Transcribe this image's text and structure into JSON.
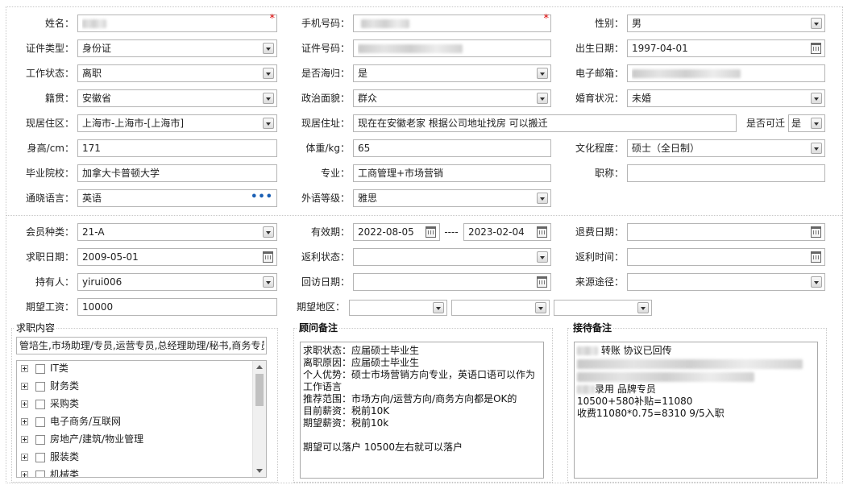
{
  "row1": {
    "name_label": "姓名：",
    "phone_label": "手机号码：",
    "gender_label": "性别：",
    "gender_value": "男",
    "required_mark": "*"
  },
  "row2": {
    "id_type_label": "证件类型：",
    "id_type_value": "身份证",
    "id_no_label": "证件号码：",
    "birth_label": "出生日期：",
    "birth_value": "1997-04-01"
  },
  "row3": {
    "work_status_label": "工作状态：",
    "work_status_value": "离职",
    "overseas_label": "是否海归：",
    "overseas_value": "是",
    "email_label": "电子邮箱："
  },
  "row4": {
    "native_label": "籍贯：",
    "native_value": "安徽省",
    "political_label": "政治面貌：",
    "political_value": "群众",
    "marital_label": "婚育状况：",
    "marital_value": "未婚"
  },
  "row5": {
    "area_label": "现居住区：",
    "area_value": "上海市-上海市-[上海市]",
    "address_label": "现居住址：",
    "address_value": "现在在安徽老家 根据公司地址找房 可以搬迁",
    "relocate_label": "是否可迁",
    "relocate_value": "是"
  },
  "row6": {
    "height_label": "身高/cm：",
    "height_value": "171",
    "weight_label": "体重/kg：",
    "weight_value": "65",
    "education_label": "文化程度：",
    "education_value": "硕士（全日制）"
  },
  "row7": {
    "school_label": "毕业院校：",
    "school_value": "加拿大卡普顿大学",
    "major_label": "专业：",
    "major_value": "工商管理+市场营销",
    "title_label": "职称：",
    "title_value": ""
  },
  "row8": {
    "language_label": "通晓语言：",
    "language_value": "英语",
    "foreign_level_label": "外语等级：",
    "foreign_level_value": "雅思"
  },
  "row9": {
    "member_label": "会员种类：",
    "member_value": "21-A",
    "validity_label": "有效期：",
    "validity_start": "2022-08-05",
    "validity_sep": "----",
    "validity_end": "2023-02-04",
    "refund_date_label": "退费日期："
  },
  "row10": {
    "job_date_label": "求职日期：",
    "job_date_value": "2009-05-01",
    "rebate_status_label": "返利状态：",
    "rebate_time_label": "返利时间："
  },
  "row11": {
    "holder_label": "持有人：",
    "holder_value": "yirui006",
    "visit_date_label": "回访日期：",
    "source_label": "来源途径："
  },
  "row12": {
    "salary_label": "期望工资：",
    "salary_value": "10000",
    "region_label": "期望地区："
  },
  "job_content": {
    "title": "求职内容",
    "summary": "管培生,市场助理/专员,运营专员,总经理助理/秘书,商务专员",
    "categories": [
      "IT类",
      "财务类",
      "采购类",
      "电子商务/互联网",
      "房地产/建筑/物业管理",
      "服装类",
      "机械类"
    ]
  },
  "consultant_notes": {
    "title": "顾问备注",
    "text": "求职状态：应届硕士毕业生\n离职原因：应届硕士毕业生\n个人优势：硕士市场营销方向专业，英语口语可以作为工作语言\n推荐范围：市场方向/运营方向/商务方向都是OK的\n目前薪资：税前10K\n期望薪资：税前10k\n\n期望可以落户 10500左右就可以落户"
  },
  "reception_notes": {
    "title": "接待备注",
    "line1": "转账 协议已回传",
    "line4": "录用  品牌专员",
    "line5": "10500+580补贴=11080",
    "line6": "收费11080*0.75=8310  9/5入职"
  }
}
